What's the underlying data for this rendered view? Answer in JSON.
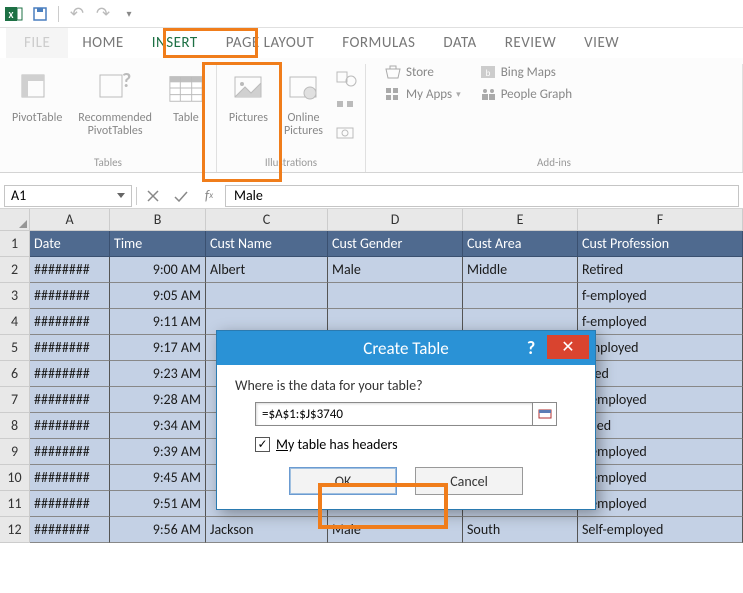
{
  "qat": {
    "undo": "↶",
    "redo": "↷"
  },
  "tabs": {
    "file": "FILE",
    "home": "HOME",
    "insert": "INSERT",
    "pagelayout": "PAGE LAYOUT",
    "formulas": "FORMULAS",
    "data": "DATA",
    "review": "REVIEW",
    "view": "VIEW"
  },
  "ribbon": {
    "pivottable": "PivotTable",
    "recpivottables": "Recommended\nPivotTables",
    "table": "Table",
    "pictures": "Pictures",
    "onlinepictures": "Online\nPictures",
    "tables_group": "Tables",
    "illustrations_group": "Illustrations",
    "addins_group": "Add-ins",
    "store": "Store",
    "myapps": "My Apps",
    "bingmaps": "Bing Maps",
    "peoplegraph": "People Graph"
  },
  "namebox": "A1",
  "formula": "Male",
  "columns": [
    "A",
    "B",
    "C",
    "D",
    "E",
    "F"
  ],
  "colwidths": [
    "cw-A",
    "cw-B",
    "cw-C",
    "cw-D",
    "cw-E",
    "cw-F"
  ],
  "header_row": [
    "Date",
    "Time",
    "Cust Name",
    "Cust Gender",
    "Cust Area",
    "Cust Profession"
  ],
  "rows": [
    [
      "########",
      "9:00 AM",
      "Albert",
      "Male",
      "Middle",
      "Retired"
    ],
    [
      "########",
      "9:05 AM",
      "",
      "",
      "",
      "f-employed"
    ],
    [
      "########",
      "9:11 AM",
      "",
      "",
      "",
      "f-employed"
    ],
    [
      "########",
      "9:17 AM",
      "",
      "",
      "",
      "employed"
    ],
    [
      "########",
      "9:23 AM",
      "",
      "",
      "",
      "tired"
    ],
    [
      "########",
      "9:28 AM",
      "",
      "",
      "",
      "f-employed"
    ],
    [
      "########",
      "9:34 AM",
      "",
      "",
      "",
      "aried"
    ],
    [
      "########",
      "9:39 AM",
      "",
      "",
      "",
      "f-employed"
    ],
    [
      "########",
      "9:45 AM",
      "",
      "",
      "",
      "f-employed"
    ],
    [
      "########",
      "9:51 AM",
      "",
      "",
      "",
      "f-employed"
    ],
    [
      "########",
      "9:56 AM",
      "Jackson",
      "Male",
      "South",
      "Self-employed"
    ]
  ],
  "dialog": {
    "title": "Create Table",
    "question": "Where is the data for your table?",
    "range": "=$A$1:$J$3740",
    "checkbox": "My table has headers",
    "ok": "OK",
    "cancel": "Cancel",
    "help": "?",
    "close": "✕",
    "check_mark": "✓"
  }
}
